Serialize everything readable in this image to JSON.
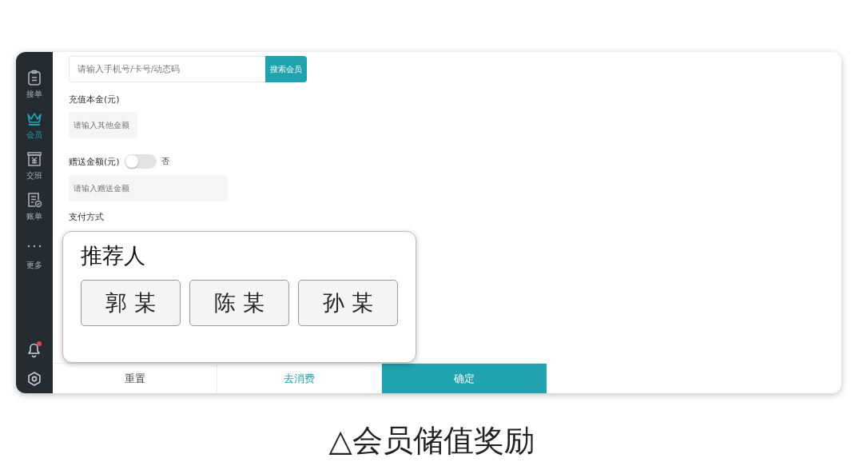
{
  "sidebar": {
    "items": [
      {
        "kind": "clipboard",
        "label": "接单",
        "selected": false
      },
      {
        "kind": "crown",
        "label": "会员",
        "selected": true
      },
      {
        "kind": "yen",
        "label": "交班",
        "selected": false
      },
      {
        "kind": "bill",
        "label": "账单",
        "selected": false
      },
      {
        "kind": "dots",
        "label": "更多",
        "selected": false
      }
    ],
    "notification": {
      "unread": true
    }
  },
  "search": {
    "placeholder": "请输入手机号/卡号/动态码",
    "button": "搜索会员"
  },
  "recharge": {
    "label": "充值本金(元)",
    "placeholder": "请输入其他金额"
  },
  "bonus": {
    "label": "赠送金额(元)",
    "on": false,
    "state_text": "否",
    "placeholder": "请输入赠送金额"
  },
  "payment": {
    "label": "支付方式"
  },
  "referrer_popup": {
    "title": "推荐人",
    "options": [
      "郭 某",
      "陈 某",
      "孙 某"
    ]
  },
  "footer": {
    "buttons": [
      {
        "label": "重置",
        "kind": "plain"
      },
      {
        "label": "去消费",
        "kind": "link"
      },
      {
        "label": "确定",
        "kind": "primary"
      }
    ]
  },
  "caption": "△会员储值奖励"
}
